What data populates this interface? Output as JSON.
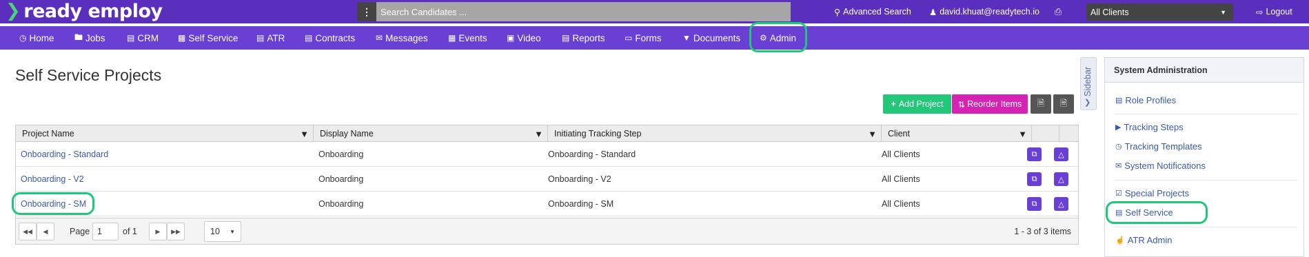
{
  "app": {
    "logo_text": "ready employ"
  },
  "topbar": {
    "search_placeholder": "Search Candidates ...",
    "advanced_search": "Advanced Search",
    "user_email": "david.khuat@readytech.io",
    "client_filter": "All Clients",
    "logout": "Logout"
  },
  "nav": {
    "items": [
      {
        "label": "Home"
      },
      {
        "label": "Jobs"
      },
      {
        "label": "CRM"
      },
      {
        "label": "Self Service"
      },
      {
        "label": "ATR"
      },
      {
        "label": "Contracts"
      },
      {
        "label": "Messages"
      },
      {
        "label": "Events"
      },
      {
        "label": "Video"
      },
      {
        "label": "Reports"
      },
      {
        "label": "Forms"
      },
      {
        "label": "Documents"
      },
      {
        "label": "Admin"
      }
    ]
  },
  "page": {
    "title": "Self Service Projects",
    "add_project": "Add Project",
    "reorder_items": "Reorder Items"
  },
  "grid": {
    "columns": [
      "Project Name",
      "Display Name",
      "Initiating Tracking Step",
      "Client"
    ],
    "rows": [
      {
        "project_name": "Onboarding - Standard",
        "display_name": "Onboarding",
        "tracking_step": "Onboarding - Standard",
        "client": "All Clients"
      },
      {
        "project_name": "Onboarding - V2",
        "display_name": "Onboarding",
        "tracking_step": "Onboarding - V2",
        "client": "All Clients"
      },
      {
        "project_name": "Onboarding - SM",
        "display_name": "Onboarding",
        "tracking_step": "Onboarding - SM",
        "client": "All Clients"
      }
    ],
    "pager": {
      "page_label": "Page",
      "page_value": "1",
      "of_label": "of 1",
      "page_size": "10",
      "summary": "1 - 3 of 3 items"
    }
  },
  "sidebar": {
    "tab_label": "Sidebar",
    "panel_title": "System Administration",
    "items": [
      {
        "label": "Role Profiles"
      },
      {
        "label": "Tracking Steps"
      },
      {
        "label": "Tracking Templates"
      },
      {
        "label": "System Notifications"
      },
      {
        "label": "Special Projects"
      },
      {
        "label": "Self Service"
      },
      {
        "label": "ATR Admin"
      }
    ]
  },
  "colors": {
    "topbar": "#5a2fbd",
    "navbar": "#6a3fd4",
    "highlight": "#1fc778",
    "add_button": "#22c77a",
    "reorder_button": "#d623b4",
    "export_button": "#555555"
  }
}
